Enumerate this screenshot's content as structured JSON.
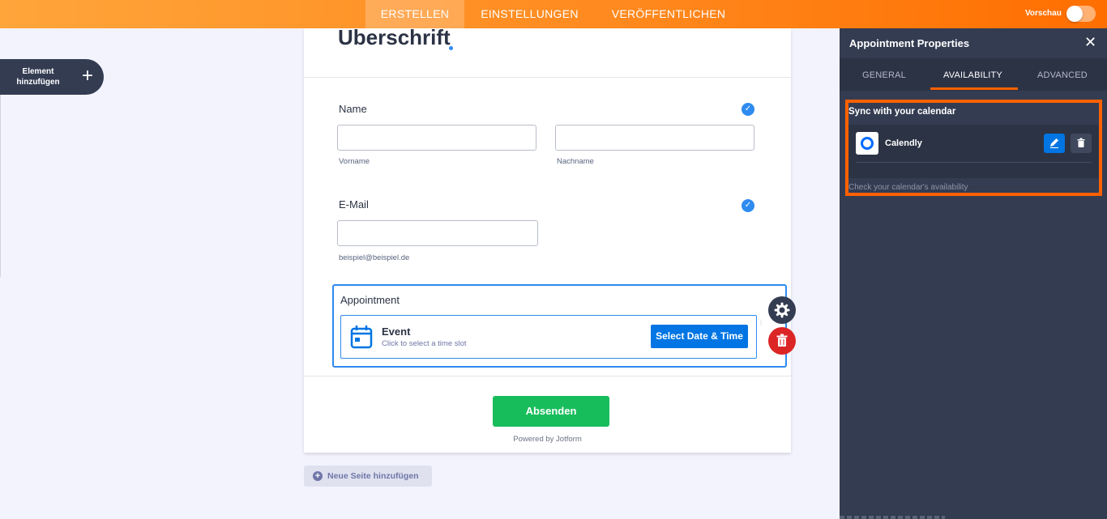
{
  "topbar": {
    "tabs": [
      {
        "label": "ERSTELLEN",
        "active": true
      },
      {
        "label": "EINSTELLUNGEN",
        "active": false
      },
      {
        "label": "VERÖFFENTLICHEN",
        "active": false
      }
    ],
    "preview_label": "Vorschau",
    "preview_enabled": false
  },
  "sidebar": {
    "add_element_label": "Element hinzufügen",
    "add_icon": "plus-icon"
  },
  "form": {
    "heading": "Uberschrift",
    "name_field": {
      "label": "Name",
      "first_sublabel": "Vorname",
      "last_sublabel": "Nachname",
      "first_value": "",
      "last_value": ""
    },
    "email_field": {
      "label": "E-Mail",
      "sublabel": "beispiel@beispiel.de",
      "value": ""
    },
    "appointment": {
      "label": "Appointment",
      "event_title": "Event",
      "event_subtitle": "Click to select a time slot",
      "select_button": "Select Date & Time"
    },
    "submit_label": "Absenden",
    "powered_by": "Powered by Jotform",
    "add_page_label": "Neue Seite hinzufügen"
  },
  "panel": {
    "title": "Appointment Properties",
    "tabs": [
      {
        "label": "GENERAL",
        "active": false
      },
      {
        "label": "AVAILABILITY",
        "active": true
      },
      {
        "label": "ADVANCED",
        "active": false
      }
    ],
    "sync": {
      "title": "Sync with your calendar",
      "calendar_name": "Calendly",
      "footnote": "Check your calendar's availability"
    }
  },
  "colors": {
    "accent_orange": "#ff6100",
    "primary_blue": "#0075e3",
    "submit_green": "#18bd5b",
    "danger_red": "#dc2626",
    "panel_bg": "#343c52"
  }
}
